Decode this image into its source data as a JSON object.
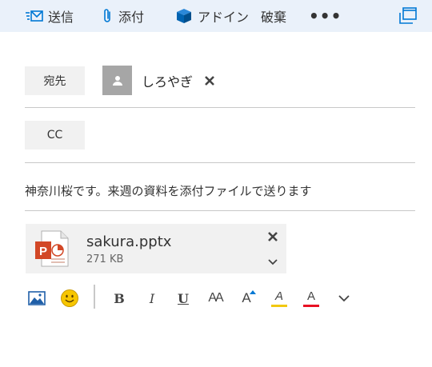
{
  "toolbar": {
    "send_label": "送信",
    "attach_label": "添付",
    "addin_label": "アドイン",
    "discard_label": "破棄",
    "more_label": "•••"
  },
  "recipients": {
    "to_label": "宛先",
    "cc_label": "CC",
    "to": [
      {
        "name": "しろやぎ"
      }
    ]
  },
  "message": {
    "subject": "神奈川桜です。来週の資料を添付ファイルで送ります"
  },
  "attachment": {
    "filename": "sakura.pptx",
    "size": "271 KB"
  },
  "format_bar": {
    "bold": "B",
    "italic": "I",
    "underline": "U",
    "font_size": "AA",
    "grow_font": "A",
    "highlight": "A",
    "font_color": "A"
  },
  "colors": {
    "accent": "#0078d4",
    "toolbar_bg": "#eaf1fa",
    "highlight": "#f2c811",
    "font_color": "#e81123",
    "pptx": "#d24726"
  },
  "icons": [
    "envelope-send-icon",
    "paperclip-icon",
    "addin-cube-icon",
    "more-icon",
    "popout-icon",
    "person-icon",
    "close-icon",
    "powerpoint-file-icon",
    "chevron-down-icon",
    "image-icon",
    "emoji-icon"
  ]
}
